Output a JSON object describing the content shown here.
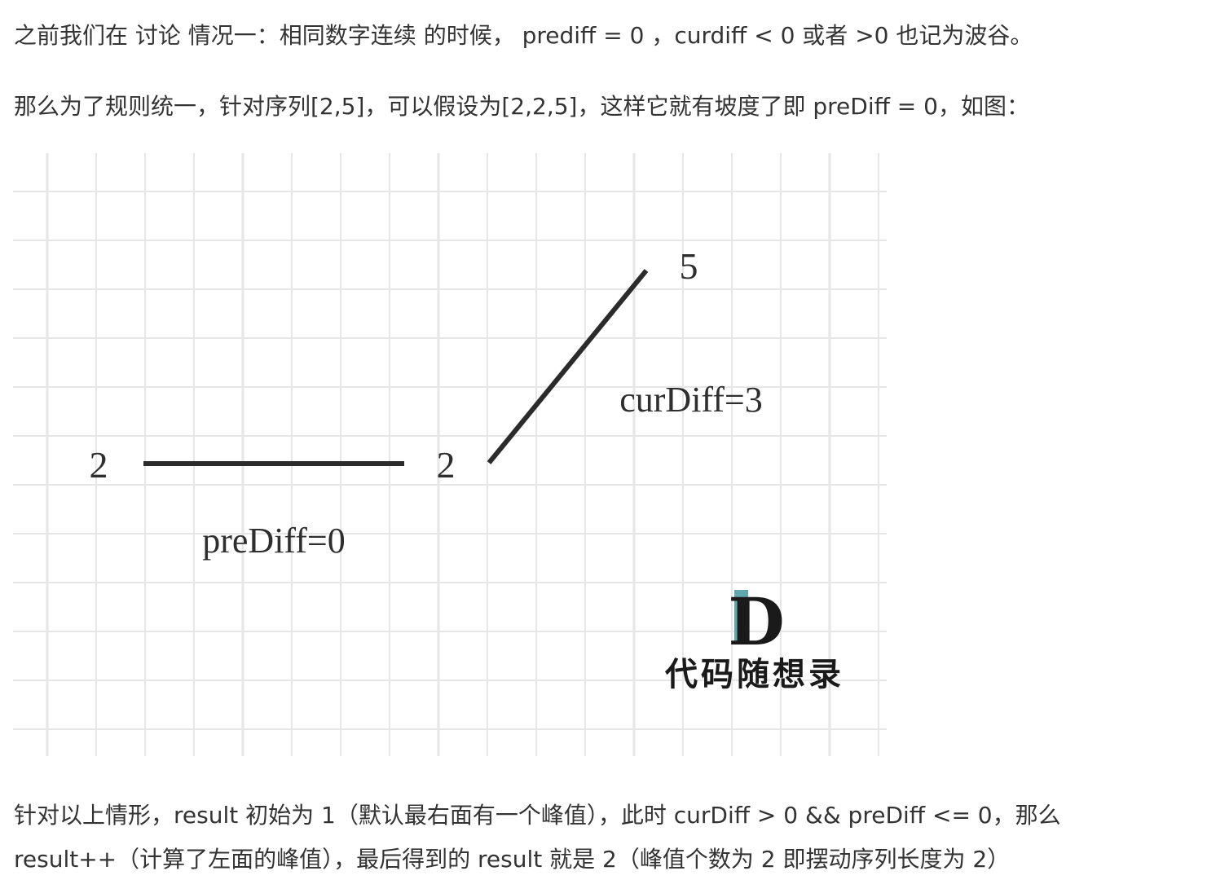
{
  "paragraphs": {
    "p1": "之前我们在 讨论 情况一：相同数字连续 的时候， prediff = 0 ，curdiff < 0 或者 >0 也记为波谷。",
    "p2": "那么为了规则统一，针对序列[2,5]，可以假设为[2,2,5]，这样它就有坡度了即 preDiff = 0，如图：",
    "p3": "针对以上情形，result 初始为 1（默认最右面有一个峰值），此时 curDiff > 0 && preDiff <= 0，那么",
    "p4": "result++（计算了左面的峰值），最后得到的 result 就是 2（峰值个数为 2 即摆动序列长度为 2）"
  },
  "figure": {
    "point_labels": [
      "2",
      "2",
      "5"
    ],
    "prediff_label": "preDiff=0",
    "curdiff_label": "curDiff=3",
    "logo_letter": "D",
    "logo_text": "代码随想录",
    "colors": {
      "grid": "#e6e6e6",
      "line": "#2b2b2b",
      "logo_accent": "#5fa8b0"
    }
  }
}
